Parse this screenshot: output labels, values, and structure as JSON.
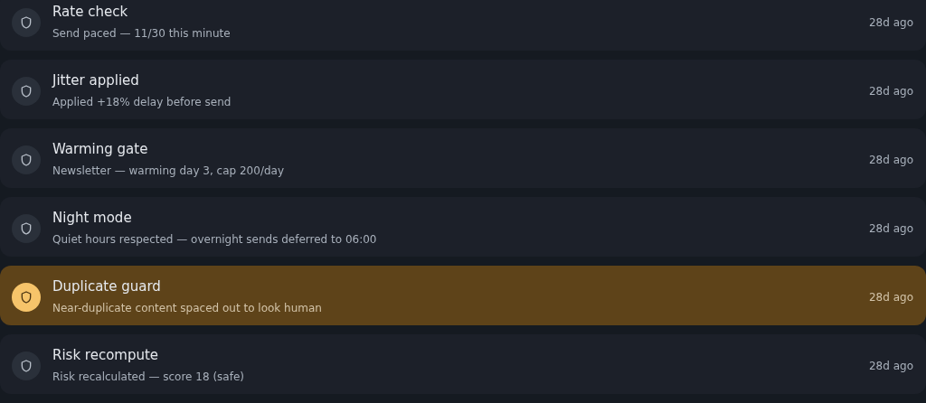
{
  "events": [
    {
      "title": "Rate check",
      "detail": "Send paced — 11/30 this minute",
      "time": "28d ago",
      "selected": false
    },
    {
      "title": "Jitter applied",
      "detail": "Applied +18% delay before send",
      "time": "28d ago",
      "selected": false
    },
    {
      "title": "Warming gate",
      "detail": "Newsletter — warming day 3, cap 200/day",
      "time": "28d ago",
      "selected": false
    },
    {
      "title": "Night mode",
      "detail": "Quiet hours respected — overnight sends deferred to 06:00",
      "time": "28d ago",
      "selected": false
    },
    {
      "title": "Duplicate guard",
      "detail": "Near-duplicate content spaced out to look human",
      "time": "28d ago",
      "selected": true
    },
    {
      "title": "Risk recompute",
      "detail": "Risk recalculated — score 18 (safe)",
      "time": "28d ago",
      "selected": false
    }
  ]
}
